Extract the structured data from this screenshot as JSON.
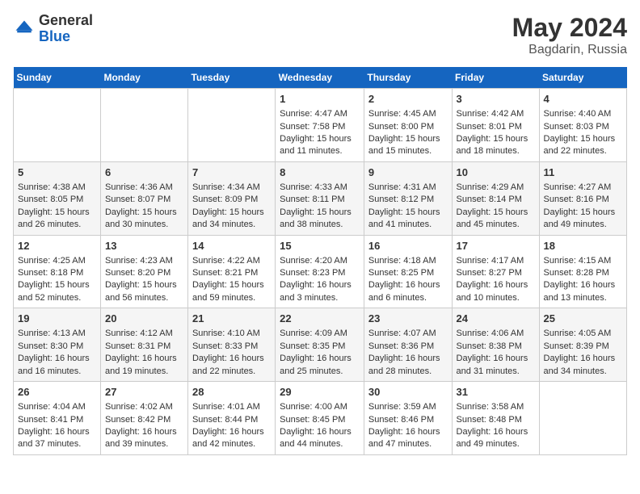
{
  "header": {
    "logo_general": "General",
    "logo_blue": "Blue",
    "month": "May 2024",
    "location": "Bagdarin, Russia"
  },
  "days_of_week": [
    "Sunday",
    "Monday",
    "Tuesday",
    "Wednesday",
    "Thursday",
    "Friday",
    "Saturday"
  ],
  "weeks": [
    [
      {
        "day": "",
        "info": ""
      },
      {
        "day": "",
        "info": ""
      },
      {
        "day": "",
        "info": ""
      },
      {
        "day": "1",
        "info": "Sunrise: 4:47 AM\nSunset: 7:58 PM\nDaylight: 15 hours and 11 minutes."
      },
      {
        "day": "2",
        "info": "Sunrise: 4:45 AM\nSunset: 8:00 PM\nDaylight: 15 hours and 15 minutes."
      },
      {
        "day": "3",
        "info": "Sunrise: 4:42 AM\nSunset: 8:01 PM\nDaylight: 15 hours and 18 minutes."
      },
      {
        "day": "4",
        "info": "Sunrise: 4:40 AM\nSunset: 8:03 PM\nDaylight: 15 hours and 22 minutes."
      }
    ],
    [
      {
        "day": "5",
        "info": "Sunrise: 4:38 AM\nSunset: 8:05 PM\nDaylight: 15 hours and 26 minutes."
      },
      {
        "day": "6",
        "info": "Sunrise: 4:36 AM\nSunset: 8:07 PM\nDaylight: 15 hours and 30 minutes."
      },
      {
        "day": "7",
        "info": "Sunrise: 4:34 AM\nSunset: 8:09 PM\nDaylight: 15 hours and 34 minutes."
      },
      {
        "day": "8",
        "info": "Sunrise: 4:33 AM\nSunset: 8:11 PM\nDaylight: 15 hours and 38 minutes."
      },
      {
        "day": "9",
        "info": "Sunrise: 4:31 AM\nSunset: 8:12 PM\nDaylight: 15 hours and 41 minutes."
      },
      {
        "day": "10",
        "info": "Sunrise: 4:29 AM\nSunset: 8:14 PM\nDaylight: 15 hours and 45 minutes."
      },
      {
        "day": "11",
        "info": "Sunrise: 4:27 AM\nSunset: 8:16 PM\nDaylight: 15 hours and 49 minutes."
      }
    ],
    [
      {
        "day": "12",
        "info": "Sunrise: 4:25 AM\nSunset: 8:18 PM\nDaylight: 15 hours and 52 minutes."
      },
      {
        "day": "13",
        "info": "Sunrise: 4:23 AM\nSunset: 8:20 PM\nDaylight: 15 hours and 56 minutes."
      },
      {
        "day": "14",
        "info": "Sunrise: 4:22 AM\nSunset: 8:21 PM\nDaylight: 15 hours and 59 minutes."
      },
      {
        "day": "15",
        "info": "Sunrise: 4:20 AM\nSunset: 8:23 PM\nDaylight: 16 hours and 3 minutes."
      },
      {
        "day": "16",
        "info": "Sunrise: 4:18 AM\nSunset: 8:25 PM\nDaylight: 16 hours and 6 minutes."
      },
      {
        "day": "17",
        "info": "Sunrise: 4:17 AM\nSunset: 8:27 PM\nDaylight: 16 hours and 10 minutes."
      },
      {
        "day": "18",
        "info": "Sunrise: 4:15 AM\nSunset: 8:28 PM\nDaylight: 16 hours and 13 minutes."
      }
    ],
    [
      {
        "day": "19",
        "info": "Sunrise: 4:13 AM\nSunset: 8:30 PM\nDaylight: 16 hours and 16 minutes."
      },
      {
        "day": "20",
        "info": "Sunrise: 4:12 AM\nSunset: 8:31 PM\nDaylight: 16 hours and 19 minutes."
      },
      {
        "day": "21",
        "info": "Sunrise: 4:10 AM\nSunset: 8:33 PM\nDaylight: 16 hours and 22 minutes."
      },
      {
        "day": "22",
        "info": "Sunrise: 4:09 AM\nSunset: 8:35 PM\nDaylight: 16 hours and 25 minutes."
      },
      {
        "day": "23",
        "info": "Sunrise: 4:07 AM\nSunset: 8:36 PM\nDaylight: 16 hours and 28 minutes."
      },
      {
        "day": "24",
        "info": "Sunrise: 4:06 AM\nSunset: 8:38 PM\nDaylight: 16 hours and 31 minutes."
      },
      {
        "day": "25",
        "info": "Sunrise: 4:05 AM\nSunset: 8:39 PM\nDaylight: 16 hours and 34 minutes."
      }
    ],
    [
      {
        "day": "26",
        "info": "Sunrise: 4:04 AM\nSunset: 8:41 PM\nDaylight: 16 hours and 37 minutes."
      },
      {
        "day": "27",
        "info": "Sunrise: 4:02 AM\nSunset: 8:42 PM\nDaylight: 16 hours and 39 minutes."
      },
      {
        "day": "28",
        "info": "Sunrise: 4:01 AM\nSunset: 8:44 PM\nDaylight: 16 hours and 42 minutes."
      },
      {
        "day": "29",
        "info": "Sunrise: 4:00 AM\nSunset: 8:45 PM\nDaylight: 16 hours and 44 minutes."
      },
      {
        "day": "30",
        "info": "Sunrise: 3:59 AM\nSunset: 8:46 PM\nDaylight: 16 hours and 47 minutes."
      },
      {
        "day": "31",
        "info": "Sunrise: 3:58 AM\nSunset: 8:48 PM\nDaylight: 16 hours and 49 minutes."
      },
      {
        "day": "",
        "info": ""
      }
    ]
  ]
}
